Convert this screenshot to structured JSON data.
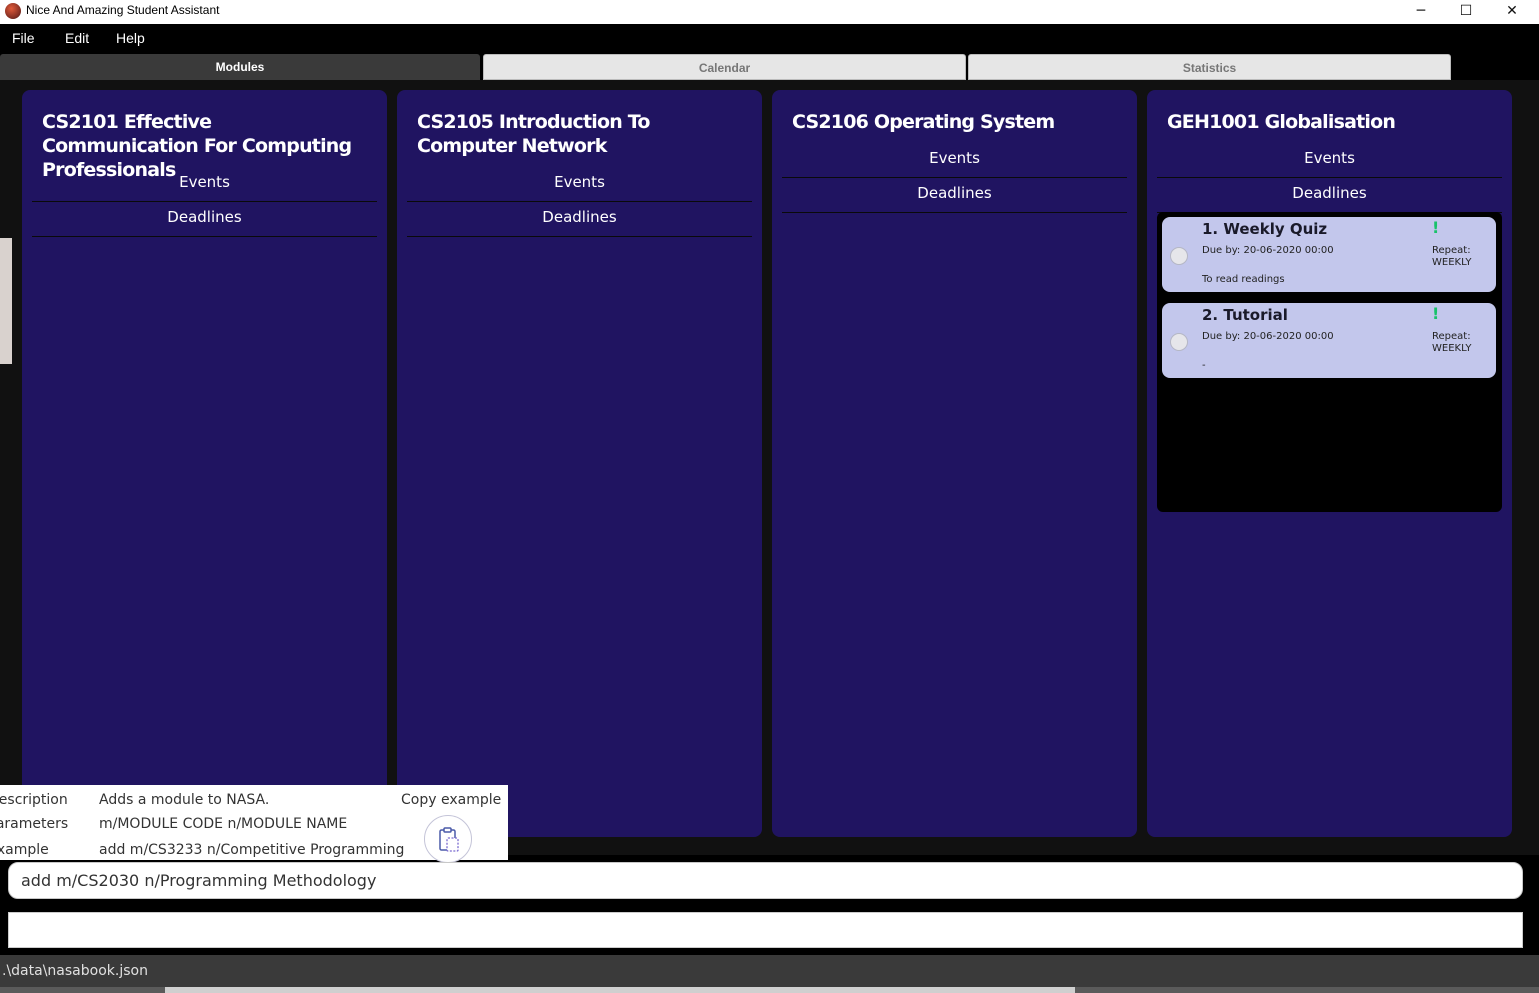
{
  "window": {
    "title": "Nice And Amazing Student Assistant",
    "controls": {
      "minimize": "─",
      "maximize": "☐",
      "close": "✕"
    }
  },
  "menu": {
    "items": [
      "File",
      "Edit",
      "Help"
    ]
  },
  "tabs": [
    {
      "label": "Modules",
      "active": true
    },
    {
      "label": "Calendar",
      "active": false
    },
    {
      "label": "Statistics",
      "active": false
    }
  ],
  "modules": [
    {
      "title": "CS2101 Effective Communication For Computing Professionals",
      "events_label": "Events",
      "deadlines_label": "Deadlines",
      "deadlines": []
    },
    {
      "title": "CS2105 Introduction To Computer Network",
      "events_label": "Events",
      "deadlines_label": "Deadlines",
      "deadlines": []
    },
    {
      "title": "CS2106 Operating System",
      "events_label": "Events",
      "deadlines_label": "Deadlines",
      "deadlines": []
    },
    {
      "title": "GEH1001 Globalisation",
      "events_label": "Events",
      "deadlines_label": "Deadlines",
      "deadlines": [
        {
          "title": "1. Weekly Quiz",
          "due": "Due by: 20-06-2020 00:00",
          "description": "To read readings",
          "mark": "!",
          "repeat_label": "Repeat:",
          "repeat_value": "WEEKLY"
        },
        {
          "title": "2. Tutorial",
          "due": "Due by: 20-06-2020 00:00",
          "description": "-",
          "mark": "!",
          "repeat_label": "Repeat:",
          "repeat_value": "WEEKLY"
        }
      ]
    }
  ],
  "help_popup": {
    "description_key": "Description",
    "description_value": "Adds a module to NASA.",
    "parameters_key": "Parameters",
    "parameters_value": "m/MODULE CODE n/MODULE NAME",
    "example_key": "Example",
    "example_value": "add m/CS3233 n/Competitive Programming",
    "copy_label": "Copy example",
    "copy_icon": "clipboard-icon"
  },
  "command": {
    "value": "add m/CS2030 n/Programming Methodology"
  },
  "result": {
    "value": ""
  },
  "status": {
    "path": ".\\data\\nasabook.json"
  },
  "colors": {
    "card_bg": "#201461",
    "deadline_card_bg": "#c3c7ec",
    "important_mark": "#18c26a",
    "tab_active": "#3a3a3a"
  }
}
